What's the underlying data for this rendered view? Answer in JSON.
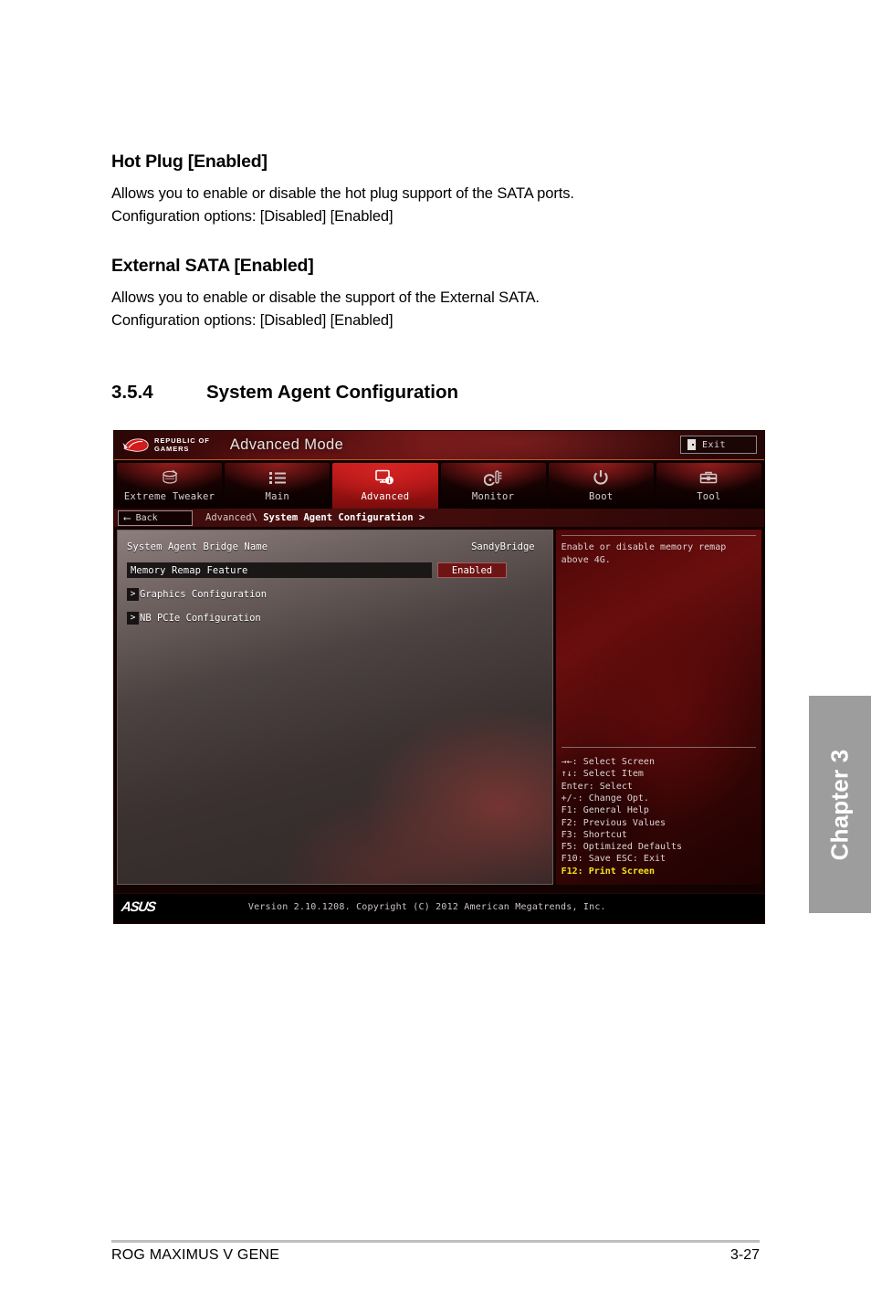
{
  "document": {
    "items": [
      {
        "heading": "Hot Plug [Enabled]",
        "line1": "Allows you to enable or disable the hot plug support of the SATA ports.",
        "line2": "Configuration options: [Disabled] [Enabled]"
      },
      {
        "heading": "External SATA [Enabled]",
        "line1": "Allows you to enable or disable the support of the External SATA.",
        "line2": "Configuration options: [Disabled] [Enabled]"
      }
    ],
    "section": {
      "number": "3.5.4",
      "title": "System Agent Configuration"
    }
  },
  "bios": {
    "brand_line1": "REPUBLIC OF",
    "brand_line2": "GAMERS",
    "mode_title": "Advanced Mode",
    "exit_label": "Exit",
    "tabs": [
      {
        "label": "Extreme Tweaker",
        "icon": "tweaker-icon",
        "active": false
      },
      {
        "label": "Main",
        "icon": "list-icon",
        "active": false
      },
      {
        "label": "Advanced",
        "icon": "monitor-info-icon",
        "active": true
      },
      {
        "label": "Monitor",
        "icon": "gauge-icon",
        "active": false
      },
      {
        "label": "Boot",
        "icon": "power-icon",
        "active": false
      },
      {
        "label": "Tool",
        "icon": "toolbox-icon",
        "active": false
      }
    ],
    "back_label": "Back",
    "breadcrumb_prefix": "Advanced\\ ",
    "breadcrumb_current": "System Agent Configuration >",
    "rows": [
      {
        "label": "System Agent Bridge Name",
        "value": "SandyBridge",
        "type": "info"
      },
      {
        "label": "Memory Remap Feature",
        "value": "Enabled",
        "type": "option",
        "selected": true
      },
      {
        "label": "Graphics Configuration",
        "value": "",
        "type": "submenu",
        "marker": ">"
      },
      {
        "label": "NB PCIe Configuration",
        "value": "",
        "type": "submenu",
        "marker": ">"
      }
    ],
    "help_text": "Enable or disable memory remap above 4G.",
    "keys": [
      "→←: Select Screen",
      "↑↓: Select Item",
      "Enter: Select",
      "+/-: Change Opt.",
      "F1: General Help",
      "F2: Previous Values",
      "F3: Shortcut",
      "F5: Optimized Defaults",
      "F10: Save  ESC: Exit",
      "F12: Print Screen"
    ],
    "footer_brand": "ASUS",
    "footer_version": "Version 2.10.1208. Copyright (C) 2012 American Megatrends, Inc."
  },
  "chapter_tab": {
    "label": "Chapter 3"
  },
  "page_footer": {
    "left": "ROG MAXIMUS V GENE",
    "right": "3-27"
  },
  "colors": {
    "accent_red": "#c81c1c",
    "highlight_yellow": "#f2e21a",
    "chapter_gray": "#9d9d9d"
  }
}
